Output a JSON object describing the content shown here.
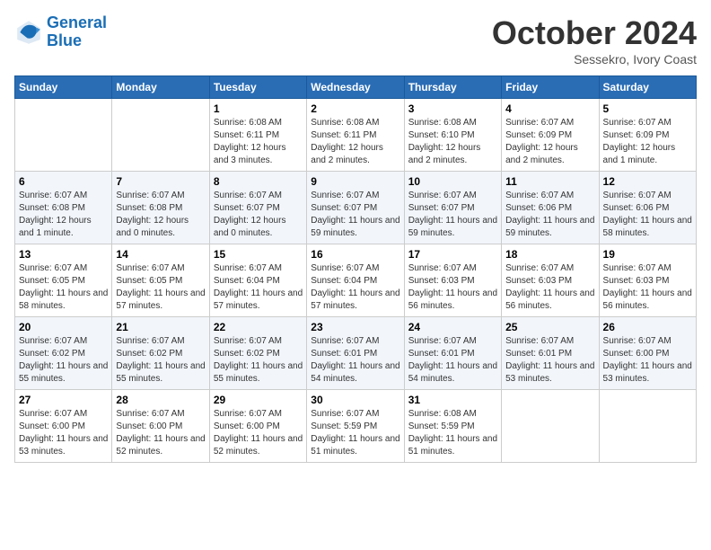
{
  "header": {
    "logo_line1": "General",
    "logo_line2": "Blue",
    "month": "October 2024",
    "location": "Sessekro, Ivory Coast"
  },
  "weekdays": [
    "Sunday",
    "Monday",
    "Tuesday",
    "Wednesday",
    "Thursday",
    "Friday",
    "Saturday"
  ],
  "weeks": [
    [
      {
        "day": "",
        "info": ""
      },
      {
        "day": "",
        "info": ""
      },
      {
        "day": "1",
        "info": "Sunrise: 6:08 AM\nSunset: 6:11 PM\nDaylight: 12 hours and 3 minutes."
      },
      {
        "day": "2",
        "info": "Sunrise: 6:08 AM\nSunset: 6:11 PM\nDaylight: 12 hours and 2 minutes."
      },
      {
        "day": "3",
        "info": "Sunrise: 6:08 AM\nSunset: 6:10 PM\nDaylight: 12 hours and 2 minutes."
      },
      {
        "day": "4",
        "info": "Sunrise: 6:07 AM\nSunset: 6:09 PM\nDaylight: 12 hours and 2 minutes."
      },
      {
        "day": "5",
        "info": "Sunrise: 6:07 AM\nSunset: 6:09 PM\nDaylight: 12 hours and 1 minute."
      }
    ],
    [
      {
        "day": "6",
        "info": "Sunrise: 6:07 AM\nSunset: 6:08 PM\nDaylight: 12 hours and 1 minute."
      },
      {
        "day": "7",
        "info": "Sunrise: 6:07 AM\nSunset: 6:08 PM\nDaylight: 12 hours and 0 minutes."
      },
      {
        "day": "8",
        "info": "Sunrise: 6:07 AM\nSunset: 6:07 PM\nDaylight: 12 hours and 0 minutes."
      },
      {
        "day": "9",
        "info": "Sunrise: 6:07 AM\nSunset: 6:07 PM\nDaylight: 11 hours and 59 minutes."
      },
      {
        "day": "10",
        "info": "Sunrise: 6:07 AM\nSunset: 6:07 PM\nDaylight: 11 hours and 59 minutes."
      },
      {
        "day": "11",
        "info": "Sunrise: 6:07 AM\nSunset: 6:06 PM\nDaylight: 11 hours and 59 minutes."
      },
      {
        "day": "12",
        "info": "Sunrise: 6:07 AM\nSunset: 6:06 PM\nDaylight: 11 hours and 58 minutes."
      }
    ],
    [
      {
        "day": "13",
        "info": "Sunrise: 6:07 AM\nSunset: 6:05 PM\nDaylight: 11 hours and 58 minutes."
      },
      {
        "day": "14",
        "info": "Sunrise: 6:07 AM\nSunset: 6:05 PM\nDaylight: 11 hours and 57 minutes."
      },
      {
        "day": "15",
        "info": "Sunrise: 6:07 AM\nSunset: 6:04 PM\nDaylight: 11 hours and 57 minutes."
      },
      {
        "day": "16",
        "info": "Sunrise: 6:07 AM\nSunset: 6:04 PM\nDaylight: 11 hours and 57 minutes."
      },
      {
        "day": "17",
        "info": "Sunrise: 6:07 AM\nSunset: 6:03 PM\nDaylight: 11 hours and 56 minutes."
      },
      {
        "day": "18",
        "info": "Sunrise: 6:07 AM\nSunset: 6:03 PM\nDaylight: 11 hours and 56 minutes."
      },
      {
        "day": "19",
        "info": "Sunrise: 6:07 AM\nSunset: 6:03 PM\nDaylight: 11 hours and 56 minutes."
      }
    ],
    [
      {
        "day": "20",
        "info": "Sunrise: 6:07 AM\nSunset: 6:02 PM\nDaylight: 11 hours and 55 minutes."
      },
      {
        "day": "21",
        "info": "Sunrise: 6:07 AM\nSunset: 6:02 PM\nDaylight: 11 hours and 55 minutes."
      },
      {
        "day": "22",
        "info": "Sunrise: 6:07 AM\nSunset: 6:02 PM\nDaylight: 11 hours and 55 minutes."
      },
      {
        "day": "23",
        "info": "Sunrise: 6:07 AM\nSunset: 6:01 PM\nDaylight: 11 hours and 54 minutes."
      },
      {
        "day": "24",
        "info": "Sunrise: 6:07 AM\nSunset: 6:01 PM\nDaylight: 11 hours and 54 minutes."
      },
      {
        "day": "25",
        "info": "Sunrise: 6:07 AM\nSunset: 6:01 PM\nDaylight: 11 hours and 53 minutes."
      },
      {
        "day": "26",
        "info": "Sunrise: 6:07 AM\nSunset: 6:00 PM\nDaylight: 11 hours and 53 minutes."
      }
    ],
    [
      {
        "day": "27",
        "info": "Sunrise: 6:07 AM\nSunset: 6:00 PM\nDaylight: 11 hours and 53 minutes."
      },
      {
        "day": "28",
        "info": "Sunrise: 6:07 AM\nSunset: 6:00 PM\nDaylight: 11 hours and 52 minutes."
      },
      {
        "day": "29",
        "info": "Sunrise: 6:07 AM\nSunset: 6:00 PM\nDaylight: 11 hours and 52 minutes."
      },
      {
        "day": "30",
        "info": "Sunrise: 6:07 AM\nSunset: 5:59 PM\nDaylight: 11 hours and 51 minutes."
      },
      {
        "day": "31",
        "info": "Sunrise: 6:08 AM\nSunset: 5:59 PM\nDaylight: 11 hours and 51 minutes."
      },
      {
        "day": "",
        "info": ""
      },
      {
        "day": "",
        "info": ""
      }
    ]
  ]
}
